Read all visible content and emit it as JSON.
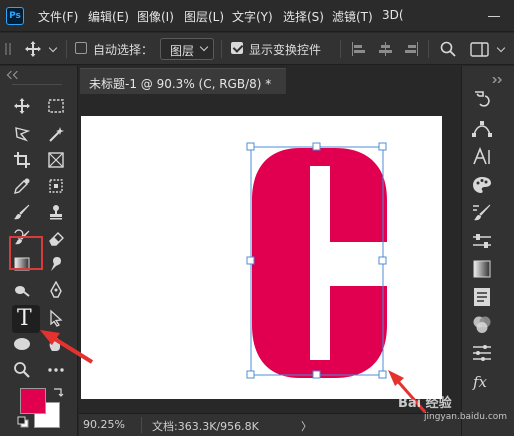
{
  "app": {
    "logo_text": "Ps"
  },
  "menu": [
    "文件(F)",
    "编辑(E)",
    "图像(I)",
    "图层(L)",
    "文字(Y)",
    "选择(S)",
    "滤镜(T)",
    "3D("
  ],
  "options": {
    "auto_select_label": "自动选择：",
    "auto_select_checked": false,
    "layer_select_value": "图层",
    "show_transform_label": "显示变换控件",
    "show_transform_checked": true
  },
  "document": {
    "tab_title": "未标题-1 @ 90.3% (C, RGB/8) *",
    "canvas_letter": "C",
    "letter_color": "#e10050",
    "zoom": "90.25%",
    "info": "文档:363.3K/956.8K",
    "info_arrow": "〉"
  },
  "colors": {
    "foreground": "#e10050",
    "background": "#ffffff"
  },
  "toolbar": {
    "tools": [
      "move-tool",
      "marquee-tool",
      "lasso-tool",
      "magic-wand-tool",
      "crop-tool",
      "frame-tool",
      "eyedropper-tool",
      "spot-heal-tool",
      "brush-tool",
      "stamp-tool",
      "history-brush-tool",
      "eraser-tool",
      "gradient-tool",
      "smudge-tool",
      "dodge-tool",
      "pen-tool",
      "type-tool",
      "path-select-tool",
      "ellipse-tool",
      "hand-tool",
      "zoom-tool",
      "more-tools"
    ],
    "selected_tool": "type-tool",
    "type_tool_glyph": "T"
  },
  "watermark": {
    "main": "Bai 经验",
    "sub": "jingyan.baidu.com"
  }
}
